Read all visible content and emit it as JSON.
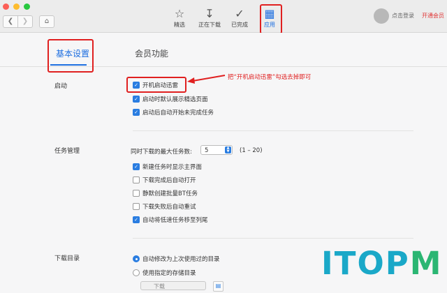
{
  "toolbar": {
    "items": [
      {
        "label": "精选",
        "icon": "star-icon"
      },
      {
        "label": "正在下载",
        "icon": "download-icon"
      },
      {
        "label": "已完成",
        "icon": "check-circle-icon"
      },
      {
        "label": "应用",
        "icon": "apps-icon"
      }
    ],
    "login": "点击登录",
    "vip": "开通会员"
  },
  "tabs": [
    "基本设置",
    "会员功能"
  ],
  "annotation": "把“开机启动迅雷”勾选去掉即可",
  "sections": {
    "startup": {
      "title": "启动",
      "options": [
        {
          "label": "开机启动迅雷",
          "checked": true
        },
        {
          "label": "启动时默认展示精选页面",
          "checked": true
        },
        {
          "label": "启动后自动开始未完成任务",
          "checked": true
        }
      ]
    },
    "tasks": {
      "title": "任务管理",
      "max_label": "同时下载的最大任务数:",
      "max_value": "5",
      "max_range": "(1 – 20)",
      "options": [
        {
          "label": "新建任务时显示主界面",
          "checked": true
        },
        {
          "label": "下载完成后自动打开",
          "checked": false
        },
        {
          "label": "静默创建批量BT任务",
          "checked": false
        },
        {
          "label": "下载失败后自动重试",
          "checked": false
        },
        {
          "label": "自动将低速任务移至列尾",
          "checked": true
        }
      ]
    },
    "dir": {
      "title": "下载目录",
      "options": [
        {
          "label": "自动修改为上次使用过的目录",
          "selected": true
        },
        {
          "label": "使用指定的存储目录",
          "selected": false
        }
      ],
      "folder": "下载"
    }
  },
  "colors": {
    "accent": "#1e6fe0",
    "annotation": "#e02020"
  },
  "watermark": {
    "left": "ITOP",
    "right": "M"
  }
}
